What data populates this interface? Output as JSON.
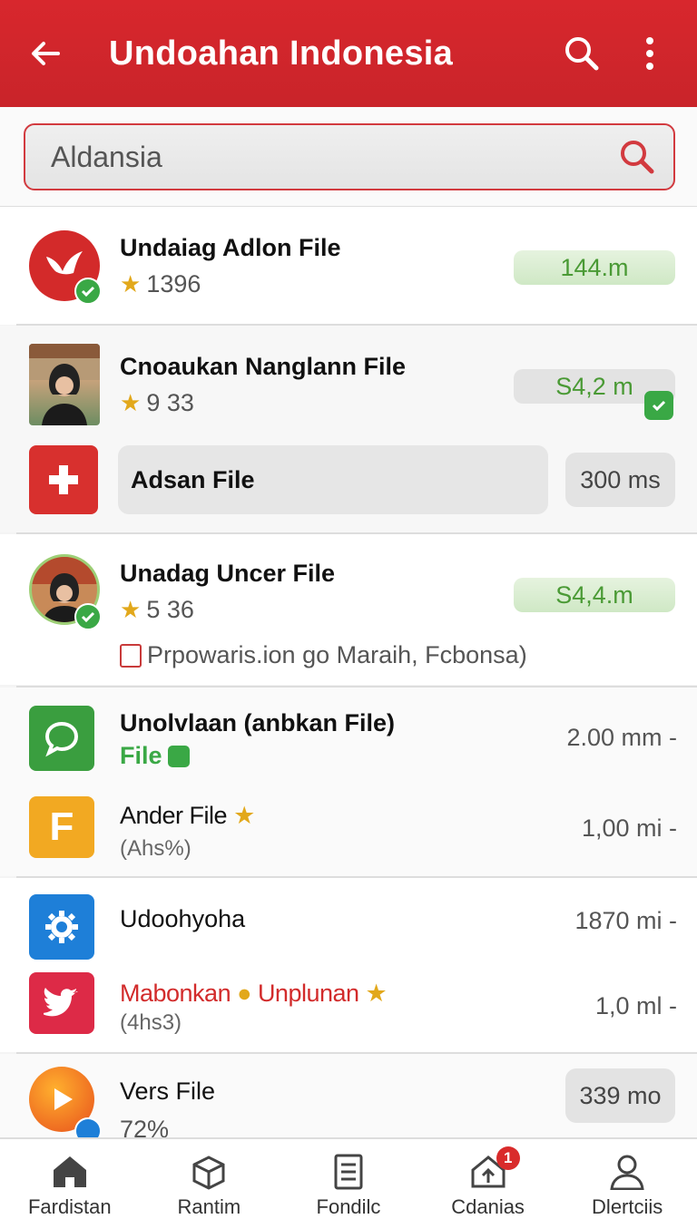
{
  "header": {
    "title": "Undoahan Indonesia",
    "back_icon": "arrow-left-icon",
    "search_icon": "search-icon",
    "menu_icon": "more-vert-icon",
    "color": "#d32429"
  },
  "search": {
    "value": "Aldansia"
  },
  "items": [
    {
      "name": "Undaiag Adlon File",
      "rating": "1396",
      "size": "144.m",
      "icon": "bird-logo-icon"
    },
    {
      "name": "Cnoaukan Nanglann File",
      "rating": "9 33",
      "size": "S4,2 m",
      "icon": "person-photo"
    },
    {
      "name": "Adsan File",
      "size": "300 ms",
      "icon": "red-cross-icon"
    },
    {
      "name": "Unadag Uncer File",
      "rating": "5 36",
      "size": "S4,4.m",
      "note": "Prpowaris.ion go Maraih, Fcbonsa)",
      "icon": "person-photo"
    },
    {
      "name": "Unolvlaan (anbkan File)",
      "tag": "File",
      "size": "2.00 mm -",
      "icon": "chat-bubble-icon"
    },
    {
      "name": "Ander File",
      "meta": "(Ahs%)",
      "size": "1,00 mi -",
      "icon": "letter-f-icon"
    },
    {
      "name": "Udoohyoha",
      "size": "1870 mi -",
      "icon": "gear-icon"
    },
    {
      "name_red_1": "Mabonkan",
      "name_red_2": "Unplunan",
      "meta": "(4hs3)",
      "size": "1,0 ml -",
      "icon": "bird-icon"
    },
    {
      "name": "Vers File",
      "rating": "72%",
      "size": "339 mo",
      "icon": "play-icon"
    }
  ],
  "tabs": [
    {
      "label": "Fardistan",
      "icon": "home-icon"
    },
    {
      "label": "Rantim",
      "icon": "box-icon"
    },
    {
      "label": "Fondilc",
      "icon": "document-icon"
    },
    {
      "label": "Cdanias",
      "icon": "home-upload-icon",
      "badge": "1"
    },
    {
      "label": "Dlertciis",
      "icon": "person-icon"
    }
  ]
}
